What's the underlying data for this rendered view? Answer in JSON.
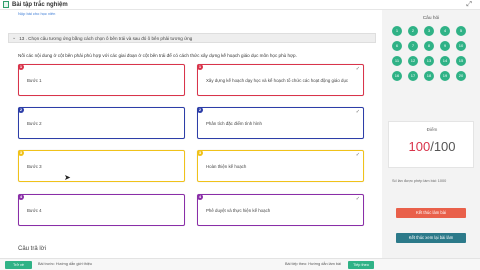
{
  "header": {
    "title": "Bài tập trắc nghiệm"
  },
  "question": {
    "sublink": "Nộp bài cho học viên",
    "heading": "13 . Chọn câu tương ứng bằng cách chọn ô bên trái và sau đó ô bên phải tương ứng",
    "prompt": "Nối các nội dung ở cột bên phải phù hợp với các giai đoạn ở cột bên trái để có cách thức xây dựng kế hoạch giáo dục môn học phù hợp."
  },
  "left_cards": [
    {
      "num": "1",
      "label": "Bước 1",
      "color": "#d9344b"
    },
    {
      "num": "2",
      "label": "Bước 2",
      "color": "#2d3ea8"
    },
    {
      "num": "3",
      "label": "Bước 3",
      "color": "#f0c21a"
    },
    {
      "num": "4",
      "label": "Bước 4",
      "color": "#8a2ea8"
    }
  ],
  "right_cards": [
    {
      "num": "1",
      "label": "Xây dựng kế hoạch dạy học và kế hoạch tổ chức các hoạt động giáo dục",
      "color": "#d9344b",
      "check": "✓"
    },
    {
      "num": "2",
      "label": "Phân tích đặc điểm tình hình",
      "color": "#2d3ea8",
      "check": "✓"
    },
    {
      "num": "3",
      "label": "Hoàn thiện kế hoạch",
      "color": "#f0c21a",
      "check": "✓"
    },
    {
      "num": "4",
      "label": "Phê duyệt và thực hiện kế hoạch",
      "color": "#8a2ea8",
      "check": "✓"
    }
  ],
  "answer_title": "Câu trả lời",
  "sidebar": {
    "title": "Câu hỏi",
    "question_numbers": [
      "1",
      "2",
      "3",
      "4",
      "5",
      "6",
      "7",
      "8",
      "9",
      "10",
      "11",
      "12",
      "13",
      "14",
      "15",
      "16",
      "17",
      "18",
      "19",
      "20"
    ],
    "score_label": "Điểm",
    "score_value": "100",
    "score_sep": "/",
    "score_total": "100",
    "attempts": "Số lần được phép làm bài: 1000",
    "end_button": "Kết thúc làm bài",
    "review_button": "Kết thúc xem lại bài làm"
  },
  "footer": {
    "back_button": "Trở về",
    "prev_label": "Bài trước: Hướng dẫn giới thiệu",
    "next_label": "Bài tiếp theo: Hướng dẫn làm bài",
    "next_button": "Tiếp theo"
  },
  "colors": {
    "accent": "#2fb286",
    "score": "#d9344b",
    "end_btn": "#e9604a",
    "review_btn": "#2c7a8a"
  }
}
